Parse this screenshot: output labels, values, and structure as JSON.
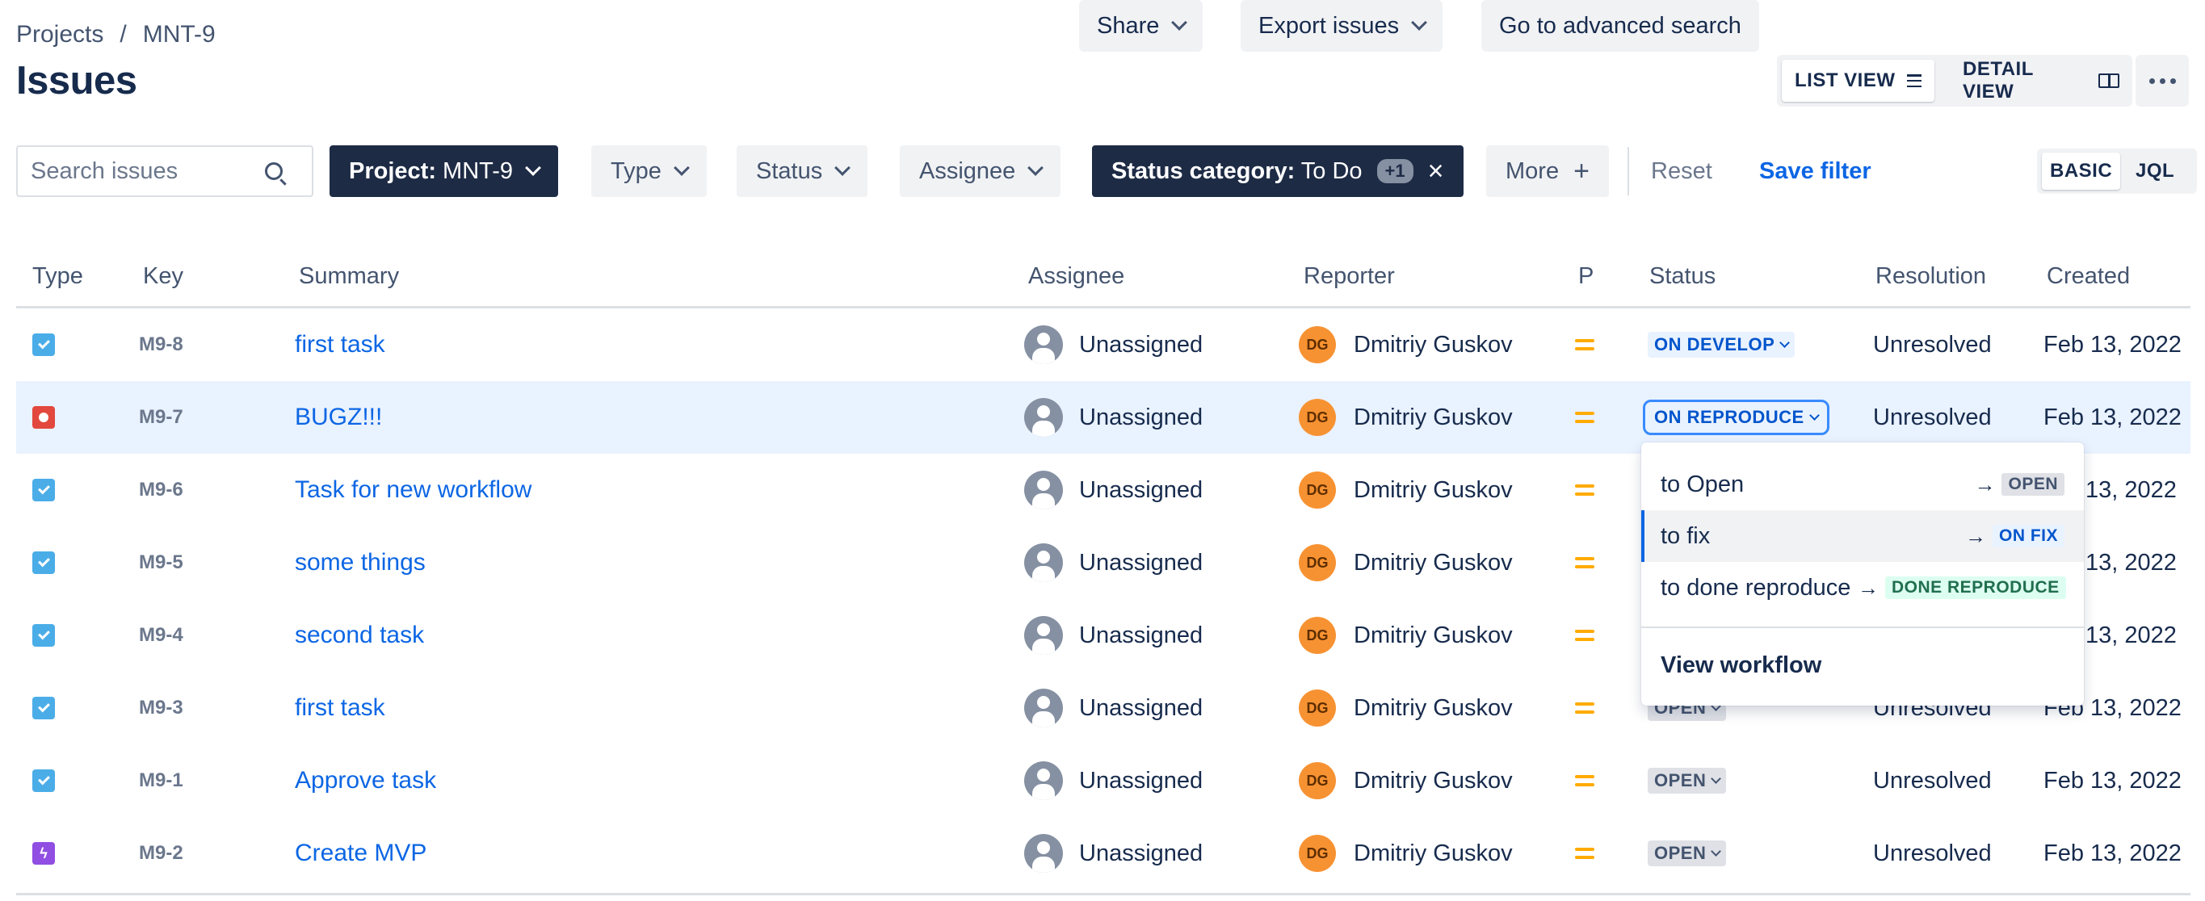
{
  "breadcrumb": {
    "projects": "Projects",
    "separator": "/",
    "project": "MNT-9"
  },
  "page_title": "Issues",
  "toolbar": {
    "share": "Share",
    "export": "Export issues",
    "advanced": "Go to advanced search",
    "list_view": "LIST VIEW",
    "detail_view": "DETAIL VIEW"
  },
  "filters": {
    "search_placeholder": "Search issues",
    "project_label": "Project:",
    "project_value": "MNT-9",
    "type": "Type",
    "status": "Status",
    "assignee": "Assignee",
    "status_category_label": "Status category:",
    "status_category_value": "To Do",
    "status_category_extra": "+1",
    "more": "More",
    "reset": "Reset",
    "save_filter": "Save filter",
    "basic": "BASIC",
    "jql": "JQL"
  },
  "columns": {
    "type": "Type",
    "key": "Key",
    "summary": "Summary",
    "assignee": "Assignee",
    "reporter": "Reporter",
    "priority": "P",
    "status": "Status",
    "resolution": "Resolution",
    "created": "Created"
  },
  "rows": [
    {
      "type": "task",
      "key": "M9-8",
      "summary": "first task",
      "assignee": "Unassigned",
      "reporter_initials": "DG",
      "reporter": "Dmitriy Guskov",
      "status": "ON DEVELOP",
      "resolution": "Unresolved",
      "created": "Feb 13, 2022"
    },
    {
      "type": "bug",
      "key": "M9-7",
      "summary": "BUGZ!!!",
      "assignee": "Unassigned",
      "reporter_initials": "DG",
      "reporter": "Dmitriy Guskov",
      "status": "ON REPRODUCE",
      "resolution": "Unresolved",
      "created": "Feb 13, 2022"
    },
    {
      "type": "task",
      "key": "M9-6",
      "summary": "Task for new workflow",
      "assignee": "Unassigned",
      "reporter_initials": "DG",
      "reporter": "Dmitriy Guskov",
      "status": "",
      "resolution": "",
      "created": "13, 2022"
    },
    {
      "type": "task",
      "key": "M9-5",
      "summary": "some things",
      "assignee": "Unassigned",
      "reporter_initials": "DG",
      "reporter": "Dmitriy Guskov",
      "status": "",
      "resolution": "",
      "created": "13, 2022"
    },
    {
      "type": "task",
      "key": "M9-4",
      "summary": "second task",
      "assignee": "Unassigned",
      "reporter_initials": "DG",
      "reporter": "Dmitriy Guskov",
      "status": "",
      "resolution": "",
      "created": "13, 2022"
    },
    {
      "type": "task",
      "key": "M9-3",
      "summary": "first task",
      "assignee": "Unassigned",
      "reporter_initials": "DG",
      "reporter": "Dmitriy Guskov",
      "status": "OPEN",
      "resolution": "Unresolved",
      "created": "Feb 13, 2022"
    },
    {
      "type": "task",
      "key": "M9-1",
      "summary": "Approve task",
      "assignee": "Unassigned",
      "reporter_initials": "DG",
      "reporter": "Dmitriy Guskov",
      "status": "OPEN",
      "resolution": "Unresolved",
      "created": "Feb 13, 2022"
    },
    {
      "type": "epic",
      "key": "M9-2",
      "summary": "Create MVP",
      "assignee": "Unassigned",
      "reporter_initials": "DG",
      "reporter": "Dmitriy Guskov",
      "status": "OPEN",
      "resolution": "Unresolved",
      "created": "Feb 13, 2022"
    }
  ],
  "transitions": {
    "items": [
      {
        "label": "to Open",
        "target": "OPEN",
        "color": "grey"
      },
      {
        "label": "to fix",
        "target": "ON FIX",
        "color": "blue"
      },
      {
        "label": "to done reproduce",
        "target": "DONE REPRODUCE",
        "color": "green"
      }
    ],
    "view_workflow": "View workflow"
  },
  "colors": {
    "primary_dark": "#1d2b45",
    "link": "#0c66e4",
    "selected_row": "#e9f2ff",
    "priority_medium": "#ffab00",
    "reporter_avatar": "#f79232"
  },
  "icons": {
    "search": "search-icon",
    "chevron": "chevron-down-icon",
    "close": "close-icon",
    "plus": "plus-icon",
    "list": "list-view-icon",
    "detail": "detail-view-icon",
    "more": "more-icon",
    "task": "task-icon",
    "bug": "bug-icon",
    "epic": "epic-icon",
    "priority": "priority-medium-icon",
    "arrow": "arrow-right-icon"
  }
}
